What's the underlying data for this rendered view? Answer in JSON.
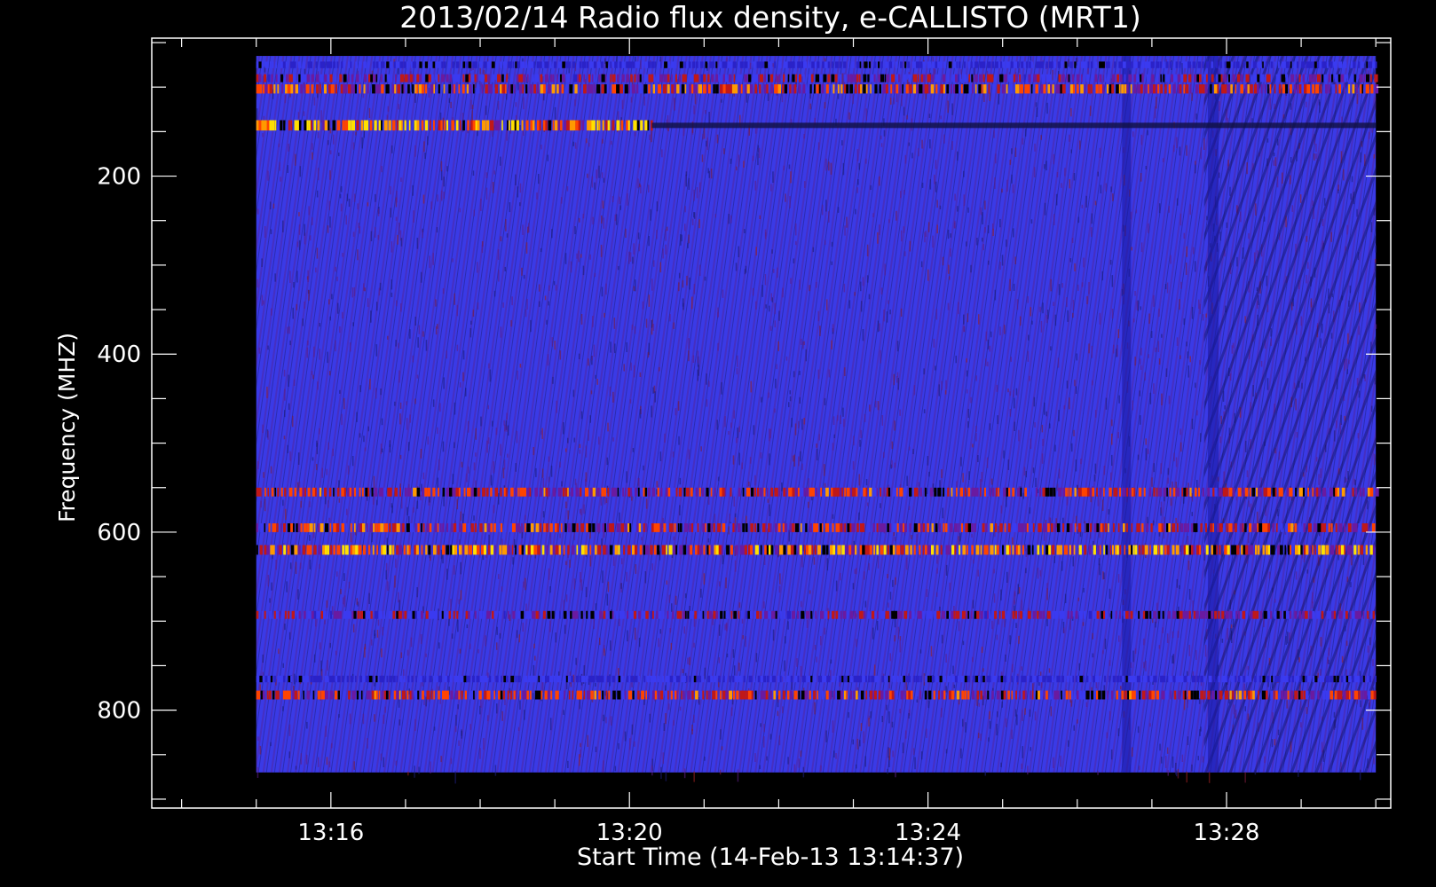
{
  "chart_data": {
    "type": "heatmap",
    "title": "2013/02/14  Radio flux density, e-CALLISTO (MRT1)",
    "xlabel": "Start Time (14-Feb-13 13:14:37)",
    "ylabel": "Frequency (MHZ)",
    "y_reversed": true,
    "xlim_minutes": [
      13.6,
      30.2
    ],
    "ylim": [
      45,
      910
    ],
    "data_x_range_minutes": [
      15.0,
      30.0
    ],
    "data_y_range": [
      65,
      870
    ],
    "x_major_ticks": [
      {
        "minutes": 16,
        "label": "13:16"
      },
      {
        "minutes": 20,
        "label": "13:20"
      },
      {
        "minutes": 24,
        "label": "13:24"
      },
      {
        "minutes": 28,
        "label": "13:28"
      }
    ],
    "x_minor_step_minutes": 1,
    "y_major_ticks": [
      {
        "value": 200,
        "label": "200"
      },
      {
        "value": 400,
        "label": "400"
      },
      {
        "value": 600,
        "label": "600"
      },
      {
        "value": 800,
        "label": "800"
      }
    ],
    "y_minor_step": 50,
    "colormap": [
      "#000000",
      "#1a0a4a",
      "#2a22c8",
      "#3a3af0",
      "#6a1aa0",
      "#c01818",
      "#ff4400",
      "#ff9a00",
      "#ffe000"
    ],
    "background_color": "#3a3ae6",
    "emission_bands": [
      {
        "freq_mhz": 75,
        "t_start": 15.0,
        "t_end": 30.0,
        "intensity": 0.35
      },
      {
        "freq_mhz": 90,
        "t_start": 15.0,
        "t_end": 30.0,
        "intensity": 0.55
      },
      {
        "freq_mhz": 102,
        "t_start": 15.0,
        "t_end": 30.0,
        "intensity": 0.75
      },
      {
        "freq_mhz": 143,
        "t_start": 15.0,
        "t_end": 20.3,
        "intensity": 0.95
      },
      {
        "freq_mhz": 143,
        "t_start": 20.3,
        "t_end": 30.0,
        "intensity": 0.1
      },
      {
        "freq_mhz": 555,
        "t_start": 15.0,
        "t_end": 30.0,
        "intensity": 0.7
      },
      {
        "freq_mhz": 595,
        "t_start": 15.0,
        "t_end": 30.0,
        "intensity": 0.7
      },
      {
        "freq_mhz": 620,
        "t_start": 15.0,
        "t_end": 30.0,
        "intensity": 0.85
      },
      {
        "freq_mhz": 693,
        "t_start": 15.0,
        "t_end": 30.0,
        "intensity": 0.55
      },
      {
        "freq_mhz": 765,
        "t_start": 15.0,
        "t_end": 30.0,
        "intensity": 0.35
      },
      {
        "freq_mhz": 783,
        "t_start": 15.0,
        "t_end": 30.0,
        "intensity": 0.7
      }
    ]
  }
}
